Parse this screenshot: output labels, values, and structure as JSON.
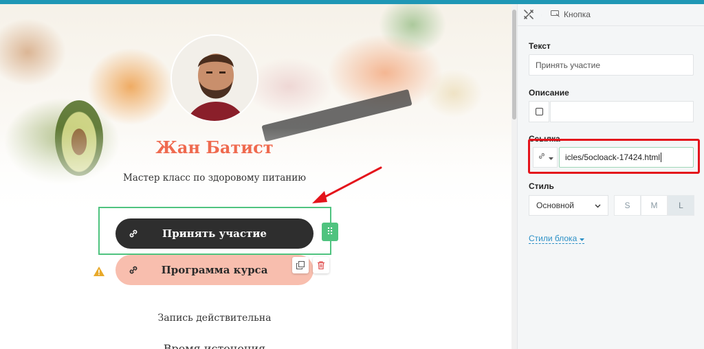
{
  "page": {
    "person_name": "Жан Батист",
    "subtitle": "Мастер класс по здоровому питанию",
    "primary_button": {
      "label": "Принять участие",
      "icon": "link-icon"
    },
    "secondary_button": {
      "label": "Программа курса",
      "icon": "link-icon"
    },
    "record_text": "Запись действительна",
    "time_text": "Время истечения"
  },
  "panel": {
    "breadcrumb": {
      "label": "Кнопка",
      "icon": "button-icon"
    },
    "text_field": {
      "label": "Текст",
      "value": "Принять участие"
    },
    "description_field": {
      "label": "Описание",
      "value": ""
    },
    "link_field": {
      "label": "Ссылка",
      "value": "icles/5ocloack-17424.html",
      "type_icon": "link-icon"
    },
    "style_field": {
      "label": "Стиль",
      "selected": "Основной",
      "sizes": [
        "S",
        "M",
        "L"
      ],
      "active_size": "L"
    },
    "block_styles": "Стили блока"
  },
  "colors": {
    "accent": "#1f97b5",
    "name_color": "#ef6a4f",
    "selection": "#4fc37f",
    "primary_button": "#2e2e2e",
    "secondary_button": "#f8beae",
    "highlight": "#e4131b",
    "link": "#2a8fc6"
  }
}
